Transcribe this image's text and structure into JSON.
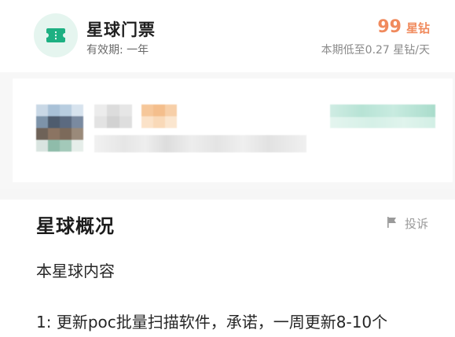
{
  "ticket": {
    "icon": "ticket-icon",
    "title": "星球门票",
    "validity": "有效期: 一年",
    "price": "99",
    "price_unit": "星钻",
    "price_note": "本期低至0.27 星钻/天",
    "accent_color": "#f08a5d",
    "icon_color": "#1db082"
  },
  "overview": {
    "title": "星球概况",
    "report_label": "投诉",
    "report_icon": "flag-icon",
    "content_heading": "本星球内容",
    "content_line_1": "1: 更新poc批量扫描软件，承诺，一周更新8-10个"
  }
}
